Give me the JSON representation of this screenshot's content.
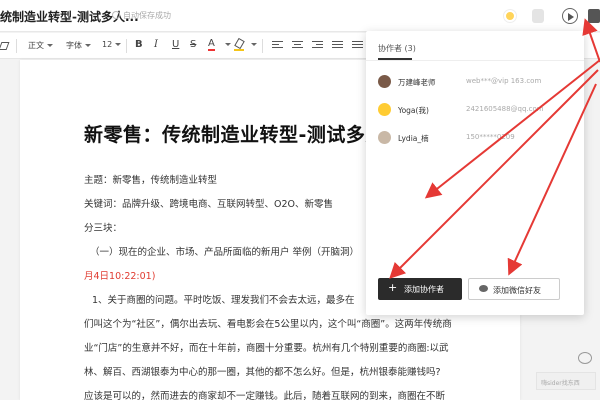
{
  "header": {
    "doc_title": "统制造业转型-测试多人...",
    "save_status": "自动保存成功"
  },
  "toolbar": {
    "style_label": "正文",
    "font_label": "字体",
    "size_label": "12",
    "bold": "B",
    "italic": "I",
    "underline": "U",
    "strike": "S",
    "color": "A"
  },
  "document": {
    "title": "新零售：传统制造业转型-测试多人",
    "lines": [
      "主题：新零售，传统制造业转型",
      "关键词：品牌升级、跨境电商、互联网转型、O2O、新零售",
      "分三块：",
      "（一）现在的企业、市场、产品所面临的新用户 举例（开脑洞）",
      "月4日10:22:01)",
      "1、关于商圈的问题。平时吃饭、理发我们不会去太远，最多在",
      "们叫这个为“社区”，偶尔出去玩、看电影会在5公里以内，这个叫“商圈”。这两年传统商",
      "业“门店”的生意并不好，而在十年前，商圈十分重要。杭州有几个特别重要的商圈:以武",
      "林、解百、西湖银泰为中心的那一圈，其他的都不怎么好。但是，杭州银泰能赚钱吗?",
      "应该是可以的，然而进去的商家却不一定赚钱。此后，随着互联网的到来，商圈在不断"
    ]
  },
  "panel": {
    "title": "协作者 (3)",
    "collaborators": [
      {
        "name": "万建峰老师",
        "contact": "web***@vip 163.com"
      },
      {
        "name": "Yoga(我)",
        "contact": "2421605488@qq.com"
      },
      {
        "name": "Lydia_楠",
        "contact": "150*****0209"
      }
    ],
    "add_button": "添加协作者",
    "wechat_button": "添加微信好友"
  },
  "footer": {
    "search_hint": "嗨sider找东西"
  },
  "colors": {
    "accent_red": "#e03c31",
    "dark_button": "#2b2b2b"
  }
}
